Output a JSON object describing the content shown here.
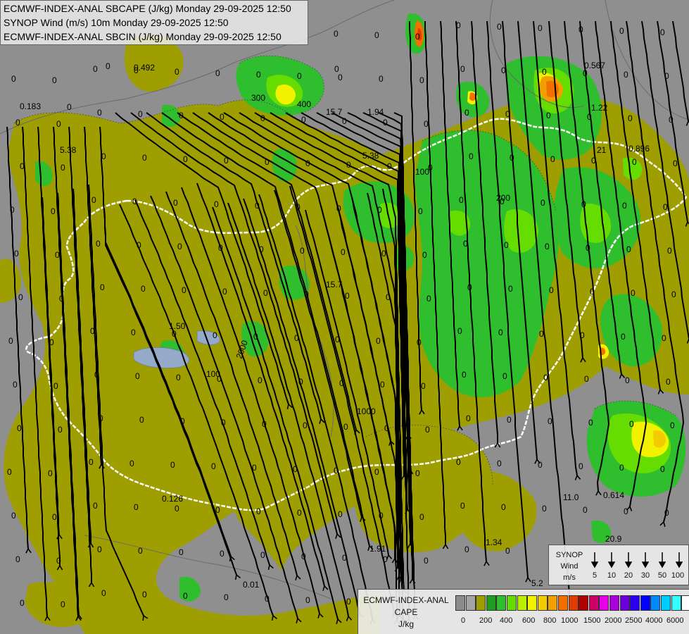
{
  "header": {
    "line1": "ECMWF-INDEX-ANAL SBCAPE (J/kg) Monday 29-09-2025 12:50",
    "line2": "SYNOP Wind (m/s) 10m Monday 29-09-2025 12:50",
    "line3": "ECMWF-INDEX-ANAL SBCIN (J/kg) Monday 29-09-2025 12:50"
  },
  "wind_legend": {
    "title1": "SYNOP",
    "title2": "Wind",
    "unit": "m/s",
    "values": [
      "5",
      "10",
      "20",
      "30",
      "50",
      "100"
    ]
  },
  "cape_legend": {
    "title1": "ECMWF-INDEX-ANAL",
    "title2": "CAPE",
    "unit": "J/kg",
    "ticks": [
      "0",
      "200",
      "400",
      "600",
      "800",
      "1000",
      "1500",
      "2000",
      "2500",
      "4000",
      "6000"
    ],
    "colors": [
      "#8c8c8c",
      "#a3a3a3",
      "#9e9e00",
      "#1f9e1f",
      "#2ebe2e",
      "#66dd00",
      "#bbf000",
      "#f2f200",
      "#f2cc00",
      "#f29f00",
      "#f26f00",
      "#e23b00",
      "#b20000",
      "#cc0066",
      "#e600e6",
      "#aa00dd",
      "#6c00dd",
      "#2a00ee",
      "#0000ff",
      "#0088ff",
      "#00ccff",
      "#33ffff",
      "#ffffff"
    ]
  },
  "colors": {
    "background": "#8f8f8f",
    "cape_low": "#9e9e00",
    "border": "#ffffff",
    "water": "#94aac8"
  },
  "map_labels": [
    "0",
    "0.492",
    "0",
    "0.183",
    "0",
    "15.7",
    "1.94",
    "5.38",
    "5.38",
    "1.50",
    "100",
    "1000",
    "300",
    "400",
    "200",
    "100",
    "0.567",
    "1.22",
    "21",
    "0.896",
    "15.7",
    "0.126",
    "11.0",
    "0.614",
    "20.9",
    "1.34",
    "1.91",
    "0.01",
    "5.2",
    "2000"
  ]
}
